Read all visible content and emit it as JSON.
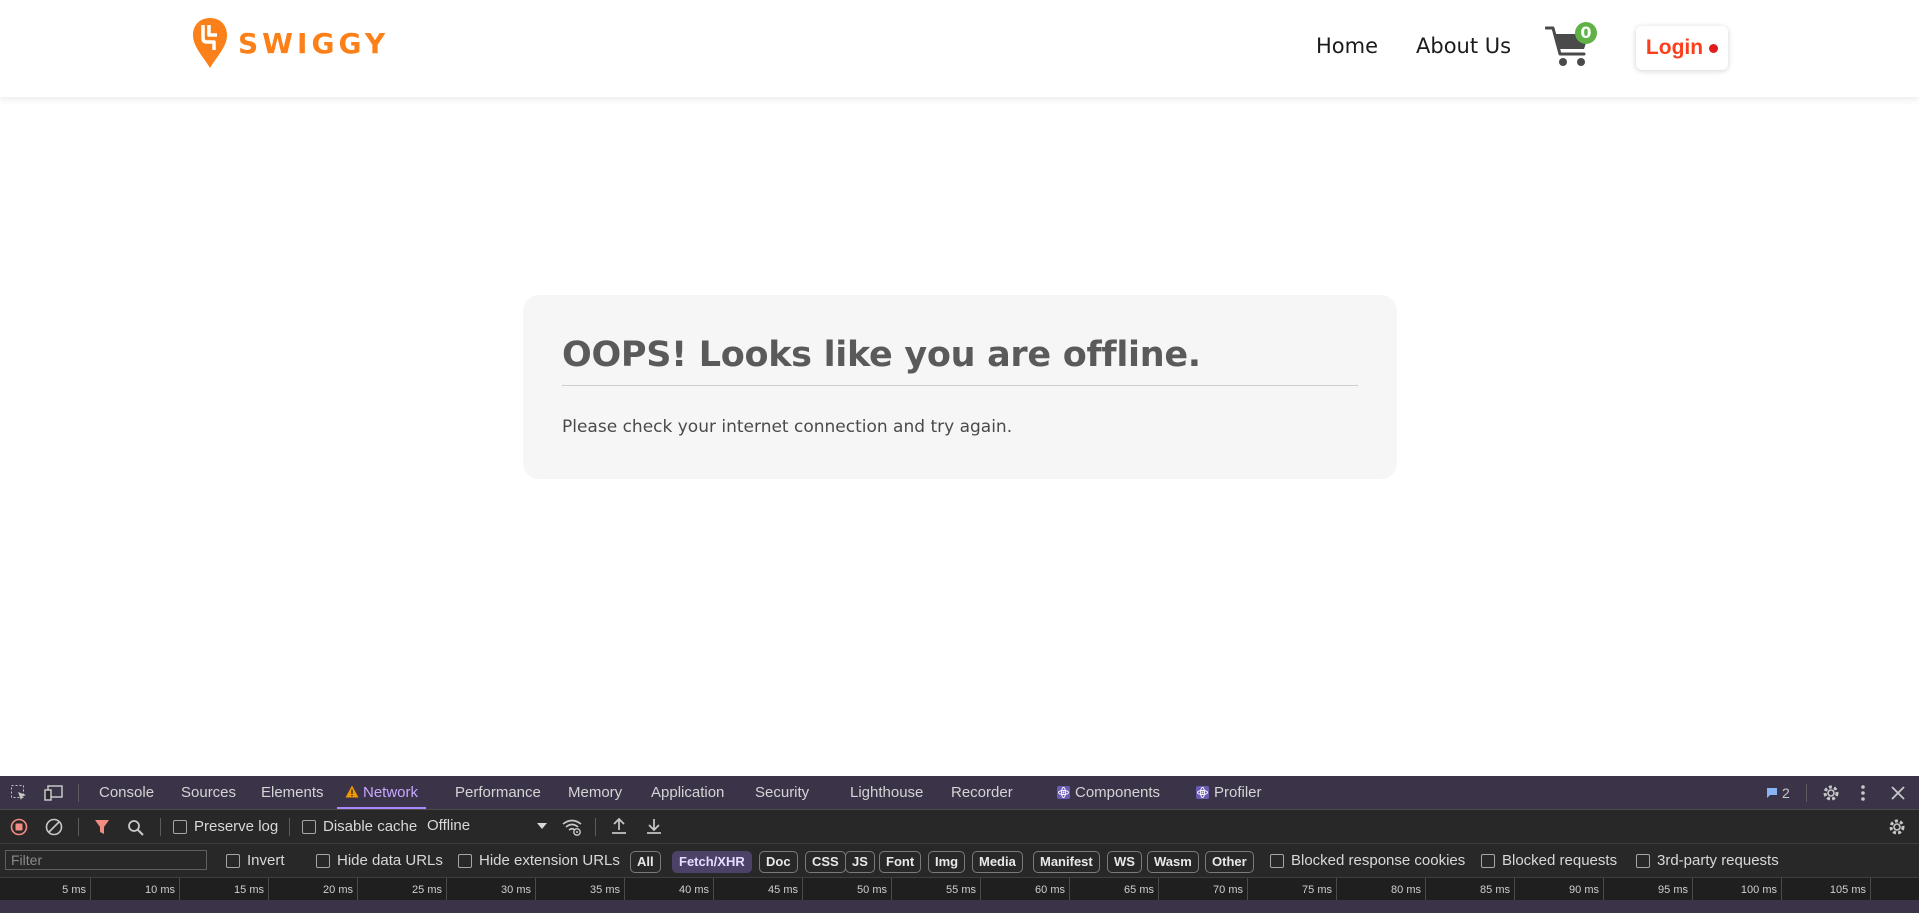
{
  "header": {
    "logo_text": "SWIGGY",
    "brand_color": "#fc8019",
    "nav": {
      "home": "Home",
      "about": "About Us"
    },
    "cart_count": "0",
    "login_label": "Login",
    "login_status_color": "#e31b1b"
  },
  "offline": {
    "title": "OOPS! Looks like you are offline.",
    "message": "Please check your internet connection and try again."
  },
  "devtools": {
    "tabs": [
      "Console",
      "Sources",
      "Elements",
      "Network",
      "Performance",
      "Memory",
      "Application",
      "Security",
      "Lighthouse",
      "Recorder",
      "Components",
      "Profiler"
    ],
    "active_tab": "Network",
    "issues_count": "2",
    "toolbar": {
      "preserve_log": "Preserve log",
      "disable_cache": "Disable cache",
      "throttling": "Offline"
    },
    "filter": {
      "placeholder": "Filter",
      "invert": "Invert",
      "hide_data_urls": "Hide data URLs",
      "hide_extension_urls": "Hide extension URLs",
      "types": [
        "All",
        "Fetch/XHR",
        "Doc",
        "CSS",
        "JS",
        "Font",
        "Img",
        "Media",
        "Manifest",
        "WS",
        "Wasm",
        "Other"
      ],
      "selected_type": "Fetch/XHR",
      "blocked_response_cookies": "Blocked response cookies",
      "blocked_requests": "Blocked requests",
      "third_party_requests": "3rd-party requests"
    },
    "timeline_ticks": [
      "5 ms",
      "10 ms",
      "15 ms",
      "20 ms",
      "25 ms",
      "30 ms",
      "35 ms",
      "40 ms",
      "45 ms",
      "50 ms",
      "55 ms",
      "60 ms",
      "65 ms",
      "70 ms",
      "75 ms",
      "80 ms",
      "85 ms",
      "90 ms",
      "95 ms",
      "100 ms",
      "105 ms"
    ]
  }
}
